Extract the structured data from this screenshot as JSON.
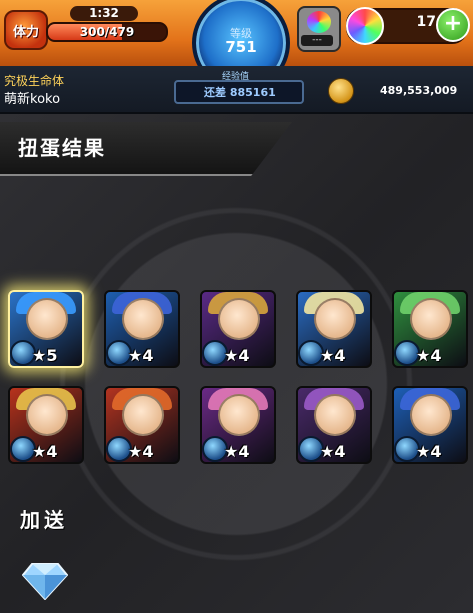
{
  "topbar": {
    "stamina_label": "体力",
    "stamina_timer": "1:32",
    "stamina_value": "300/479",
    "stamina_fraction": 0.63,
    "level_label": "等级",
    "level_value": "751",
    "stage_value": "---",
    "orb_count": "17",
    "plus_label": "+"
  },
  "infobar": {
    "player_title": "究极生命体",
    "player_name": "萌新koko",
    "exp_label": "经验值",
    "exp_text": "还差 885161",
    "coins": "489,553,009"
  },
  "main": {
    "header": "扭蛋结果",
    "bonus_label": "加送",
    "cards": [
      {
        "stars": "★5",
        "bg": "#2a73c9",
        "hair": "#3a9bff",
        "glow": true
      },
      {
        "stars": "★4",
        "bg": "#1e5fb0",
        "hair": "#3d64d8",
        "glow": false
      },
      {
        "stars": "★4",
        "bg": "#5a2a86",
        "hair": "#d7a53c",
        "glow": false
      },
      {
        "stars": "★4",
        "bg": "#2a6cc2",
        "hair": "#f2e6a1",
        "glow": false
      },
      {
        "stars": "★4",
        "bg": "#2f8f3e",
        "hair": "#6fd06a",
        "glow": false
      },
      {
        "stars": "★4",
        "bg": "#b8331c",
        "hair": "#e7c24b",
        "glow": false
      },
      {
        "stars": "★4",
        "bg": "#b33420",
        "hair": "#e26a2a",
        "glow": false
      },
      {
        "stars": "★4",
        "bg": "#6b2a86",
        "hair": "#e47ab8",
        "glow": false
      },
      {
        "stars": "★4",
        "bg": "#4a2a6a",
        "hair": "#9a5ac8",
        "glow": false
      },
      {
        "stars": "★4",
        "bg": "#1d5fb6",
        "hair": "#3c66d8",
        "glow": false
      }
    ]
  }
}
